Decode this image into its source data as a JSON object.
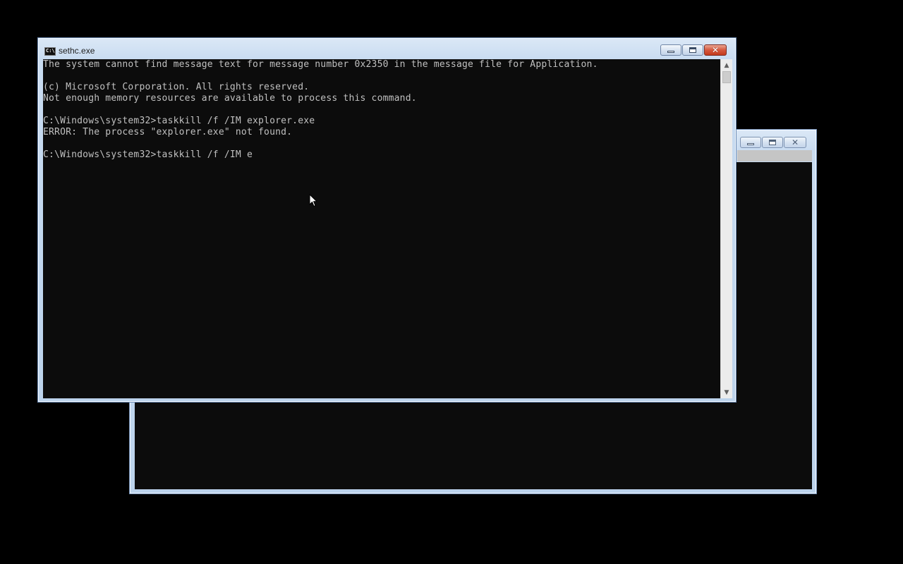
{
  "back_window": {
    "buttons": {
      "minimize": "minimize",
      "maximize": "maximize",
      "close": "close"
    }
  },
  "front_window": {
    "title": "sethc.exe",
    "icon_label": "C:\\",
    "lines": [
      "The system cannot find message text for message number 0x2350 in the message file for Application.",
      "",
      "(c) Microsoft Corporation. All rights reserved.",
      "Not enough memory resources are available to process this command.",
      "",
      "C:\\Windows\\system32>taskkill /f /IM explorer.exe",
      "ERROR: The process \"explorer.exe\" not found.",
      "",
      "C:\\Windows\\system32>taskkill /f /IM e"
    ],
    "scrollbar": {
      "up_arrow": "▲",
      "down_arrow": "▼"
    }
  },
  "colors": {
    "desktop": "#000000",
    "console_bg": "#0c0c0c",
    "console_text": "#c0c0c0",
    "frame": "#c9dcf1",
    "close_button": "#c33a1c"
  },
  "icons": [
    "console-app-icon",
    "minimize-icon",
    "maximize-icon",
    "close-icon",
    "scroll-up-icon",
    "scroll-down-icon",
    "mouse-pointer-icon"
  ]
}
